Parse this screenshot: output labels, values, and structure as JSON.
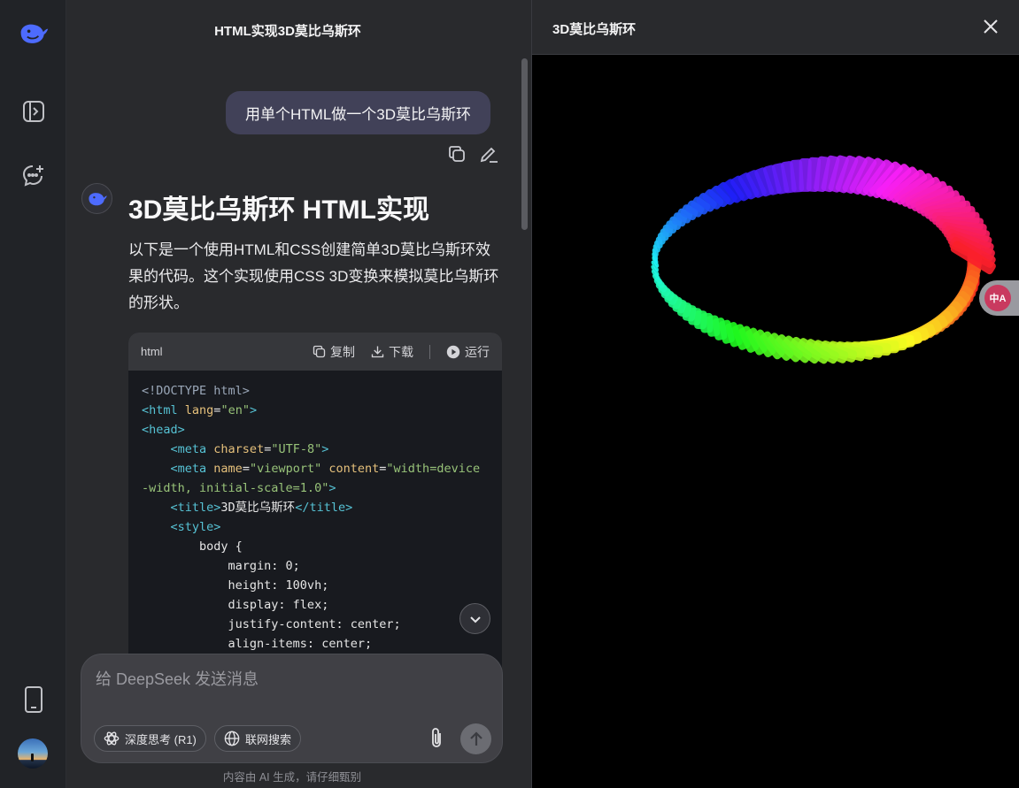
{
  "chat": {
    "title": "HTML实现3D莫比乌斯环",
    "user_message": "用单个HTML做一个3D莫比乌斯环",
    "heading": "3D莫比乌斯环 HTML实现",
    "paragraph": "以下是一个使用HTML和CSS创建简单3D莫比乌斯环效果的代码。这个实现使用CSS 3D变换来模拟莫比乌斯环的形状。",
    "code_block": {
      "language": "html",
      "copy_label": "复制",
      "download_label": "下载",
      "run_label": "运行",
      "lines": [
        "<!DOCTYPE html>",
        "<html lang=\"en\">",
        "<head>",
        "    <meta charset=\"UTF-8\">",
        "    <meta name=\"viewport\" content=\"width=device-width, initial-scale=1.0\">",
        "    <title>3D莫比乌斯环</title>",
        "    <style>",
        "        body {",
        "            margin: 0;",
        "            height: 100vh;",
        "            display: flex;",
        "            justify-content: center;",
        "            align-items: center;"
      ]
    },
    "composer": {
      "placeholder": "给 DeepSeek 发送消息",
      "deep_think_label": "深度思考 (R1)",
      "web_search_label": "联网搜索"
    },
    "footer_note": "内容由 AI 生成，请仔细甄别"
  },
  "preview": {
    "title": "3D莫比乌斯环",
    "translate_badge": "中A"
  },
  "icons": {
    "logo": "deepseek-whale-icon",
    "sidebar_toggle": "sidebar-toggle-icon",
    "new_chat": "new-chat-icon",
    "mobile": "mobile-phone-icon",
    "copy": "copy-icon",
    "edit": "edit-pencil-icon",
    "download": "download-icon",
    "run": "play-icon",
    "scroll_down": "chevron-down-icon",
    "deep_think": "atom-icon",
    "web_search": "globe-icon",
    "attach": "paperclip-icon",
    "send": "arrow-up-icon",
    "close": "close-icon"
  },
  "colors": {
    "accent": "#4d6bfe",
    "background": "#292a2d",
    "rail": "#212327",
    "user_bubble": "#414158",
    "preview_canvas": "#000000"
  }
}
